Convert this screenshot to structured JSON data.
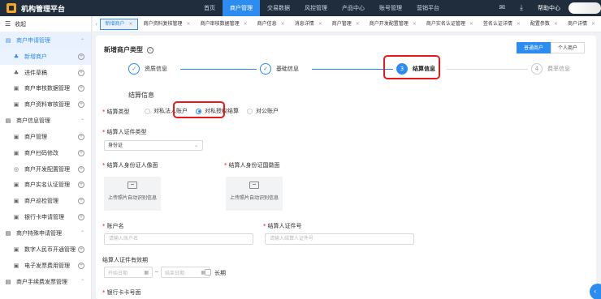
{
  "app": {
    "title": "机构管理平台"
  },
  "topnav": {
    "items": [
      "首页",
      "商户管理",
      "交易数据",
      "风控管理",
      "产品中心",
      "账号管理",
      "营销平台"
    ],
    "active_index": 1,
    "help": "帮助中心"
  },
  "sidebar": {
    "collapse_label": "收起",
    "groups": [
      {
        "label": "商户申请管理",
        "items": [
          "新增商户",
          "进件草稿",
          "商户审核数据管理",
          "商户资料审核管理"
        ]
      },
      {
        "label": "商户信息管理",
        "items": [
          "商户管理",
          "商户扫码修改",
          "商户开发配置管理",
          "商户实名认证管理",
          "商户巡检管理",
          "银行卡申请管理"
        ]
      },
      {
        "label": "商户特殊申请管理",
        "items": [
          "数字人民币开通管理",
          "电子发票费用管理"
        ]
      },
      {
        "label": "商户手续费发票管理",
        "items": []
      }
    ]
  },
  "tabs": [
    "新增商户",
    "商户资料复核管理",
    "商户审核数据管理",
    "商户信息",
    "消息详情",
    "商户管理",
    "商户开发配置管理",
    "商户实名认证管理",
    "签名认证详情",
    "配置参数",
    "商户详情"
  ],
  "page": {
    "title": "新增商户类型",
    "type_buttons": [
      "普通商户",
      "个人商户"
    ],
    "steps": [
      "资质信息",
      "基础信息",
      "结算信息",
      "费率信息"
    ],
    "current_step_number": "3",
    "todo_step_number": "4",
    "section_title": "结算信息",
    "settle_type": {
      "label": "结算类型",
      "options": [
        "对私法人账户",
        "对私授权结算",
        "对公账户"
      ],
      "selected": "对私授权结算"
    },
    "id_type": {
      "label": "结算人证件类型",
      "value": "身份证"
    },
    "id_front": {
      "label": "结算人身份证人像面",
      "upload_text": "上传照片自动识别信息"
    },
    "id_back": {
      "label": "结算人身份证国徽面",
      "upload_text": "上传照片自动识别信息"
    },
    "account_name": {
      "label": "账户名",
      "placeholder": "请输入账户名"
    },
    "id_number": {
      "label": "结算人证件号",
      "placeholder": "请输入结算人证件号"
    },
    "validity": {
      "label": "结算人证件有效期",
      "start_placeholder": "开始日期",
      "end_placeholder": "结束日期",
      "long_term": "长期"
    },
    "bank_card": {
      "label": "银行卡卡号面"
    }
  }
}
